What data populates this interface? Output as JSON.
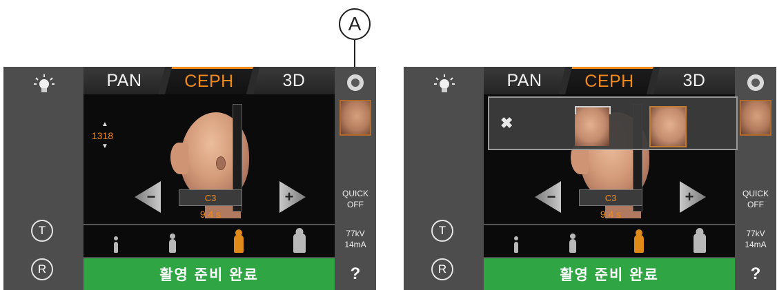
{
  "callout": {
    "label": "A"
  },
  "screens": [
    {
      "tabs": [
        "PAN",
        "CEPH",
        "3D"
      ],
      "active_tab": "CEPH",
      "height_value": "1318",
      "program_label": "C3",
      "exposure_time": "9.4 s",
      "quick_mode": [
        "QUICK",
        "OFF"
      ],
      "exposure_settings": [
        "77kV",
        "14mA"
      ],
      "ready_status": "활영 준비 완료",
      "help_label": "?",
      "left_buttons": [
        "T",
        "R"
      ]
    },
    {
      "tabs": [
        "PAN",
        "CEPH",
        "3D"
      ],
      "active_tab": "CEPH",
      "program_label": "C3",
      "exposure_time": "9.4 s",
      "quick_mode": [
        "QUICK",
        "OFF"
      ],
      "exposure_settings": [
        "77kV",
        "14mA"
      ],
      "ready_status": "활영 준비 완료",
      "help_label": "?",
      "left_buttons": [
        "T",
        "R"
      ]
    }
  ],
  "colors": {
    "accent": "#f08a1c",
    "ready_green": "#2fa544",
    "panel": "#4d4d4d"
  }
}
